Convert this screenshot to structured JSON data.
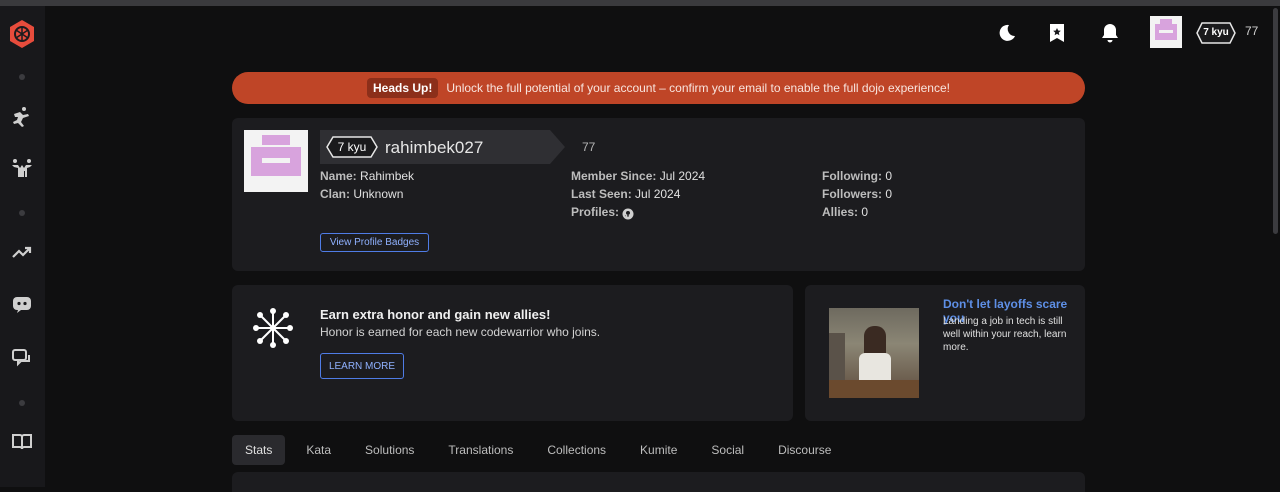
{
  "header": {
    "moon_icon": "moon-icon",
    "bookmark_icon": "bookmark-icon",
    "bell_icon": "bell-icon",
    "rank": "7 kyu",
    "honor": "77"
  },
  "banner": {
    "label": "Heads Up!",
    "message": "Unlock the full potential of your account – confirm your email to enable the full dojo experience!"
  },
  "profile": {
    "rank": "7 kyu",
    "username": "rahimbek027",
    "honor": "77",
    "col1": [
      {
        "label": "Name:",
        "value": "Rahimbek"
      },
      {
        "label": "Clan:",
        "value": "Unknown"
      }
    ],
    "col2": [
      {
        "label": "Member Since:",
        "value": "Jul 2024"
      },
      {
        "label": "Last Seen:",
        "value": "Jul 2024"
      },
      {
        "label": "Profiles:",
        "value": ""
      }
    ],
    "col3": [
      {
        "label": "Following:",
        "value": "0"
      },
      {
        "label": "Followers:",
        "value": "0"
      },
      {
        "label": "Allies:",
        "value": "0"
      }
    ],
    "badges_button": "View Profile Badges"
  },
  "honor_card": {
    "title": "Earn extra honor and gain new allies!",
    "subtitle": "Honor is earned for each new codewarrior who joins.",
    "button": "LEARN MORE"
  },
  "ad": {
    "title": "Don't let layoffs scare you",
    "text": "Landing a job in tech is still well within your reach, learn more."
  },
  "tabs": [
    "Stats",
    "Kata",
    "Solutions",
    "Translations",
    "Collections",
    "Kumite",
    "Social",
    "Discourse"
  ],
  "colors": {
    "banner": "#bf4527",
    "accent_blue": "#4f7ce6",
    "card": "#1c1c1f",
    "logo": "#e74c3c"
  }
}
